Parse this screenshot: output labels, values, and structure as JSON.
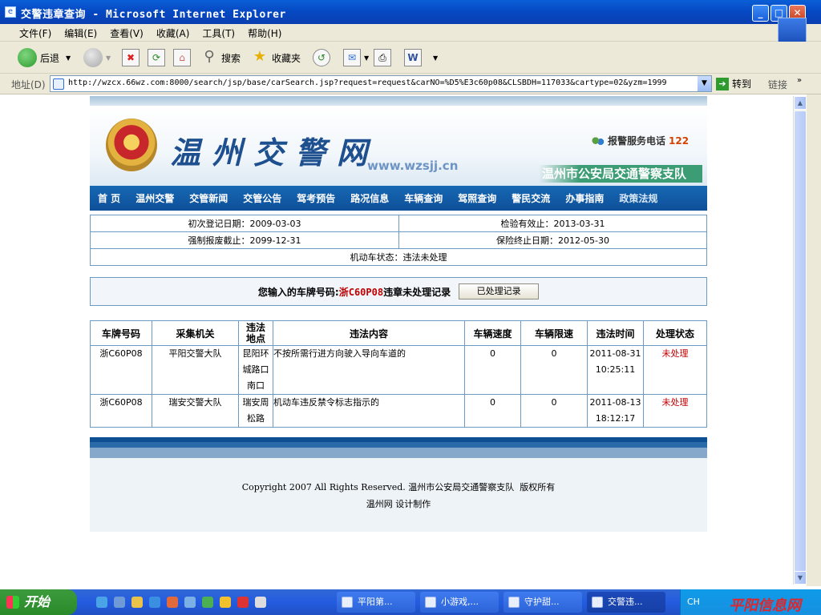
{
  "window": {
    "title": "交警违章查询 - Microsoft Internet Explorer",
    "icon": "ie-icon"
  },
  "menubar": [
    "文件(F)",
    "编辑(E)",
    "查看(V)",
    "收藏(A)",
    "工具(T)",
    "帮助(H)"
  ],
  "toolbar": {
    "back_label": "后退",
    "search_label": "搜索",
    "favorites_label": "收藏夹"
  },
  "addressbar": {
    "label": "地址(D)",
    "url": "http://wzcx.66wz.com:8000/search/jsp/base/carSearch.jsp?request=request&carNO=%D5%E3c60p08&CLSBDH=117033&cartype=02&yzm=1999",
    "go_label": "转到",
    "links_label": "链接"
  },
  "site": {
    "name": "温州交警网",
    "domain": "www.wzsjj.cn",
    "hotline_label": "报警服务电话",
    "hotline_number": "122",
    "department": "温州市公安局交通警察支队",
    "nav": [
      "首 页",
      "温州交警",
      "交管新闻",
      "交管公告",
      "驾考预告",
      "路况信息",
      "车辆查询",
      "驾照查询",
      "警民交流",
      "办事指南",
      "政策法规"
    ]
  },
  "vehicle_info": {
    "first_reg": "初次登记日期：2009-03-03",
    "inspection_valid": "检验有效止：2013-03-31",
    "scrap_deadline": "强制报废截止：2099-12-31",
    "insurance_end": "保险终止日期：2012-05-30",
    "status": "机动车状态：违法未处理"
  },
  "plate_notice": {
    "prefix": "您输入的车牌号码:",
    "plate": "浙C60P08",
    "suffix": "违章未处理记录",
    "button": "已处理记录"
  },
  "violations": {
    "headers": [
      "车牌号码",
      "采集机关",
      "违法地点",
      "违法内容",
      "车辆速度",
      "车辆限速",
      "违法时间",
      "处理状态"
    ],
    "rows": [
      {
        "plate": "浙C60P08",
        "agency": "平阳交警大队",
        "location": "昆阳环城路口南口",
        "content": "不按所需行进方向驶入导向车道的",
        "speed": "0",
        "limit": "0",
        "date": "2011-08-31",
        "time": "10:25:11",
        "status": "未处理"
      },
      {
        "plate": "浙C60P08",
        "agency": "瑞安交警大队",
        "location": "瑞安周松路",
        "content": "机动车违反禁令标志指示的",
        "speed": "0",
        "limit": "0",
        "date": "2011-08-13",
        "time": "18:12:17",
        "status": "未处理"
      }
    ]
  },
  "footer": {
    "copyright": "Copyright 2007 All Rights Reserved. 温州市公安局交通警察支队  版权所有",
    "credit": "温州网 设计制作"
  },
  "taskbar": {
    "start": "开始",
    "tasks": [
      "平阳第...",
      "小游戏,...",
      "守护甜...",
      "交警违..."
    ],
    "tray_ime": "CH",
    "tray_brand": "平阳信息网"
  },
  "colors": {
    "nav_bg": "#1768b4",
    "plate_red": "#c00000",
    "border": "#6b9ac4",
    "xp_blue": "#0548c2"
  }
}
